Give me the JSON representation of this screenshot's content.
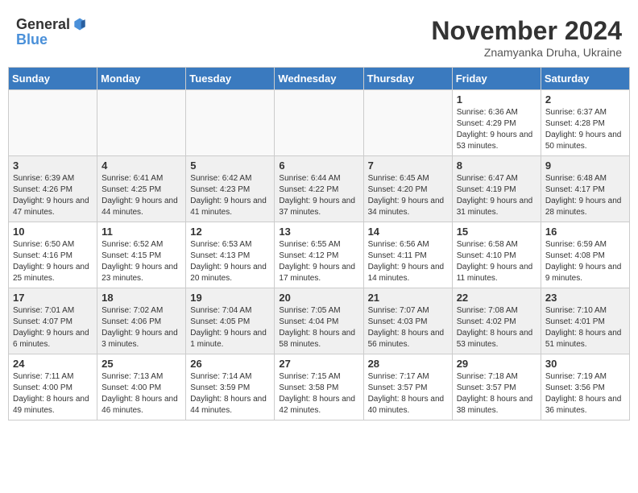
{
  "logo": {
    "general": "General",
    "blue": "Blue"
  },
  "title": "November 2024",
  "subtitle": "Znamyanka Druha, Ukraine",
  "days_header": [
    "Sunday",
    "Monday",
    "Tuesday",
    "Wednesday",
    "Thursday",
    "Friday",
    "Saturday"
  ],
  "weeks": [
    [
      {
        "day": "",
        "info": ""
      },
      {
        "day": "",
        "info": ""
      },
      {
        "day": "",
        "info": ""
      },
      {
        "day": "",
        "info": ""
      },
      {
        "day": "",
        "info": ""
      },
      {
        "day": "1",
        "info": "Sunrise: 6:36 AM\nSunset: 4:29 PM\nDaylight: 9 hours and 53 minutes."
      },
      {
        "day": "2",
        "info": "Sunrise: 6:37 AM\nSunset: 4:28 PM\nDaylight: 9 hours and 50 minutes."
      }
    ],
    [
      {
        "day": "3",
        "info": "Sunrise: 6:39 AM\nSunset: 4:26 PM\nDaylight: 9 hours and 47 minutes."
      },
      {
        "day": "4",
        "info": "Sunrise: 6:41 AM\nSunset: 4:25 PM\nDaylight: 9 hours and 44 minutes."
      },
      {
        "day": "5",
        "info": "Sunrise: 6:42 AM\nSunset: 4:23 PM\nDaylight: 9 hours and 41 minutes."
      },
      {
        "day": "6",
        "info": "Sunrise: 6:44 AM\nSunset: 4:22 PM\nDaylight: 9 hours and 37 minutes."
      },
      {
        "day": "7",
        "info": "Sunrise: 6:45 AM\nSunset: 4:20 PM\nDaylight: 9 hours and 34 minutes."
      },
      {
        "day": "8",
        "info": "Sunrise: 6:47 AM\nSunset: 4:19 PM\nDaylight: 9 hours and 31 minutes."
      },
      {
        "day": "9",
        "info": "Sunrise: 6:48 AM\nSunset: 4:17 PM\nDaylight: 9 hours and 28 minutes."
      }
    ],
    [
      {
        "day": "10",
        "info": "Sunrise: 6:50 AM\nSunset: 4:16 PM\nDaylight: 9 hours and 25 minutes."
      },
      {
        "day": "11",
        "info": "Sunrise: 6:52 AM\nSunset: 4:15 PM\nDaylight: 9 hours and 23 minutes."
      },
      {
        "day": "12",
        "info": "Sunrise: 6:53 AM\nSunset: 4:13 PM\nDaylight: 9 hours and 20 minutes."
      },
      {
        "day": "13",
        "info": "Sunrise: 6:55 AM\nSunset: 4:12 PM\nDaylight: 9 hours and 17 minutes."
      },
      {
        "day": "14",
        "info": "Sunrise: 6:56 AM\nSunset: 4:11 PM\nDaylight: 9 hours and 14 minutes."
      },
      {
        "day": "15",
        "info": "Sunrise: 6:58 AM\nSunset: 4:10 PM\nDaylight: 9 hours and 11 minutes."
      },
      {
        "day": "16",
        "info": "Sunrise: 6:59 AM\nSunset: 4:08 PM\nDaylight: 9 hours and 9 minutes."
      }
    ],
    [
      {
        "day": "17",
        "info": "Sunrise: 7:01 AM\nSunset: 4:07 PM\nDaylight: 9 hours and 6 minutes."
      },
      {
        "day": "18",
        "info": "Sunrise: 7:02 AM\nSunset: 4:06 PM\nDaylight: 9 hours and 3 minutes."
      },
      {
        "day": "19",
        "info": "Sunrise: 7:04 AM\nSunset: 4:05 PM\nDaylight: 9 hours and 1 minute."
      },
      {
        "day": "20",
        "info": "Sunrise: 7:05 AM\nSunset: 4:04 PM\nDaylight: 8 hours and 58 minutes."
      },
      {
        "day": "21",
        "info": "Sunrise: 7:07 AM\nSunset: 4:03 PM\nDaylight: 8 hours and 56 minutes."
      },
      {
        "day": "22",
        "info": "Sunrise: 7:08 AM\nSunset: 4:02 PM\nDaylight: 8 hours and 53 minutes."
      },
      {
        "day": "23",
        "info": "Sunrise: 7:10 AM\nSunset: 4:01 PM\nDaylight: 8 hours and 51 minutes."
      }
    ],
    [
      {
        "day": "24",
        "info": "Sunrise: 7:11 AM\nSunset: 4:00 PM\nDaylight: 8 hours and 49 minutes."
      },
      {
        "day": "25",
        "info": "Sunrise: 7:13 AM\nSunset: 4:00 PM\nDaylight: 8 hours and 46 minutes."
      },
      {
        "day": "26",
        "info": "Sunrise: 7:14 AM\nSunset: 3:59 PM\nDaylight: 8 hours and 44 minutes."
      },
      {
        "day": "27",
        "info": "Sunrise: 7:15 AM\nSunset: 3:58 PM\nDaylight: 8 hours and 42 minutes."
      },
      {
        "day": "28",
        "info": "Sunrise: 7:17 AM\nSunset: 3:57 PM\nDaylight: 8 hours and 40 minutes."
      },
      {
        "day": "29",
        "info": "Sunrise: 7:18 AM\nSunset: 3:57 PM\nDaylight: 8 hours and 38 minutes."
      },
      {
        "day": "30",
        "info": "Sunrise: 7:19 AM\nSunset: 3:56 PM\nDaylight: 8 hours and 36 minutes."
      }
    ]
  ]
}
